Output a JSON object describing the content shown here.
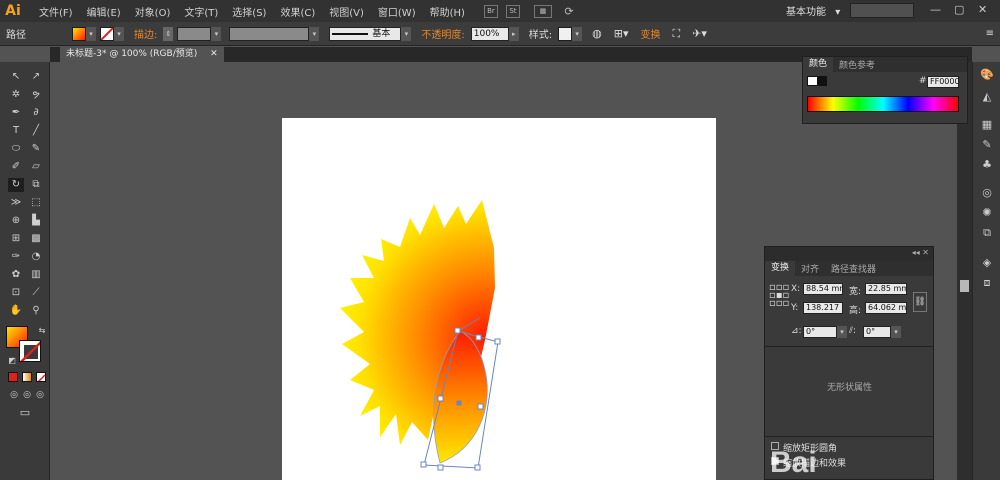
{
  "app": {
    "logo": "Ai"
  },
  "menu": [
    "文件(F)",
    "编辑(E)",
    "对象(O)",
    "文字(T)",
    "选择(S)",
    "效果(C)",
    "视图(V)",
    "窗口(W)",
    "帮助(H)"
  ],
  "menubar_icons": {
    "bridge": "Br",
    "stock": "St"
  },
  "workspace": {
    "label": "基本功能",
    "arrow": "▾"
  },
  "window_controls": {
    "minimize": "—",
    "restore": "▢",
    "close": "✕"
  },
  "control_bar": {
    "selection_label": "路径",
    "stroke_label": "描边",
    "stroke_style": "基本",
    "opacity_label": "不透明度",
    "opacity_value": "100%",
    "style_label": "样式",
    "transform_label": "变换",
    "menu_icon": "≡"
  },
  "document": {
    "tab_title": "未标题-3* @ 100% (RGB/预览)",
    "close": "✕"
  },
  "colors": {
    "fill_gradient_start": "#ffe600",
    "fill_gradient_end": "#ff1a00",
    "accent_orange": "#e3892f",
    "stroke_none_red": "#e0201c"
  },
  "color_panel": {
    "tabs": [
      "颜色",
      "颜色参考"
    ],
    "hex_prefix": "#",
    "hex_value": "FF0000"
  },
  "transform_panel": {
    "tabs": [
      "变换",
      "对齐",
      "路径查找器"
    ],
    "x_label": "X:",
    "x_value": "88.54 mm",
    "y_label": "Y:",
    "y_value": "138.217 mm",
    "w_label": "宽:",
    "w_value": "22.85 mm",
    "h_label": "高:",
    "h_value": "64.062 mm",
    "rotate_value": "0°",
    "shear_value": "0°",
    "no_shape_props": "无形状属性",
    "scale_rect_corners": "缩放矩形圆角",
    "scale_stroke_effects": "缩放描边和效果"
  },
  "watermark": {
    "text": "Bai"
  }
}
